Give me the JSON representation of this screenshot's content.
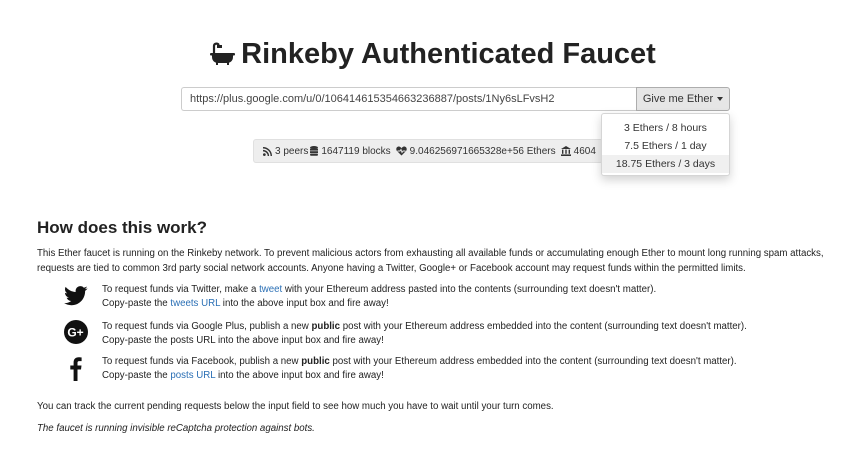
{
  "header": {
    "title": "Rinkeby Authenticated Faucet"
  },
  "form": {
    "url_value": "https://plus.google.com/u/0/106414615354663236887/posts/1Ny6sLFvsH2",
    "give_label": "Give me Ether",
    "options": [
      {
        "label": "3 Ethers / 8 hours"
      },
      {
        "label": "7.5 Ethers / 1 day"
      },
      {
        "label": "18.75 Ethers / 3 days"
      }
    ]
  },
  "stats": {
    "peers": "3 peers",
    "blocks": "1647119 blocks",
    "funds": "9.046256971665328e+56 Ethers",
    "partial": "4604"
  },
  "how": {
    "heading": "How does this work?",
    "intro": "This Ether faucet is running on the Rinkeby network. To prevent malicious actors from exhausting all available funds or accumulating enough Ether to mount long running spam attacks, requests are tied to common 3rd party social network accounts. Anyone having a Twitter, Google+ or Facebook account may request funds within the permitted limits.",
    "twitter": {
      "l1_a": "To request funds via Twitter, make a ",
      "l1_link": "tweet",
      "l1_b": " with your Ethereum address pasted into the contents (surrounding text doesn't matter).",
      "l2_a": "Copy-paste the ",
      "l2_link": "tweets URL",
      "l2_b": " into the above input box and fire away!"
    },
    "google": {
      "l1_a": "To request funds via Google Plus, publish a new ",
      "l1_bold": "public",
      "l1_b": " post with your Ethereum address embedded into the content (surrounding text doesn't matter).",
      "l2": "Copy-paste the posts URL into the above input box and fire away!"
    },
    "facebook": {
      "l1_a": "To request funds via Facebook, publish a new ",
      "l1_bold": "public",
      "l1_b": " post with your Ethereum address embedded into the content (surrounding text doesn't matter).",
      "l2_a": "Copy-paste the ",
      "l2_link": "posts URL",
      "l2_b": " into the above input box and fire away!"
    },
    "track": "You can track the current pending requests below the input field to see how much you have to wait until your turn comes.",
    "captcha": "The faucet is running invisible reCaptcha protection against bots."
  },
  "icons": [
    "bath-icon",
    "rss-icon",
    "database-icon",
    "heartbeat-icon",
    "bank-icon",
    "twitter-icon",
    "google-plus-icon",
    "facebook-icon"
  ]
}
